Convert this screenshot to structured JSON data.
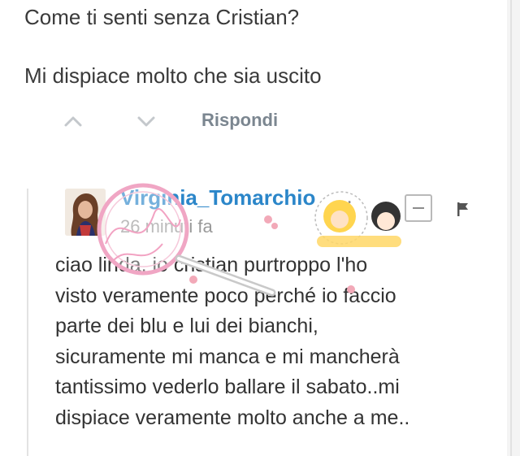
{
  "comment": {
    "line1": "Come ti senti senza Cristian?",
    "line2": "Mi dispiace molto che sia uscito"
  },
  "actions": {
    "upvote_icon": "chevron-up-icon",
    "downvote_icon": "chevron-down-icon",
    "reply_label": "Rispondi"
  },
  "reply": {
    "username": "Virginia_Tomarchio",
    "more": "...",
    "timestamp": "26 minuti fa",
    "lines": [
      "ciao linda, io cristian purtroppo l'ho",
      "visto veramente poco perché io faccio",
      "parte dei blu e lui dei bianchi,",
      "sicuramente mi manca e mi mancherà",
      "tantissimo vederlo ballare il sabato..mi",
      "dispiace veramente molto anche a me.."
    ],
    "collapse_icon": "minus-icon",
    "flag_icon": "flag-icon"
  },
  "colors": {
    "username": "#2b86c9",
    "muted": "#7b8690",
    "text": "#333333"
  }
}
